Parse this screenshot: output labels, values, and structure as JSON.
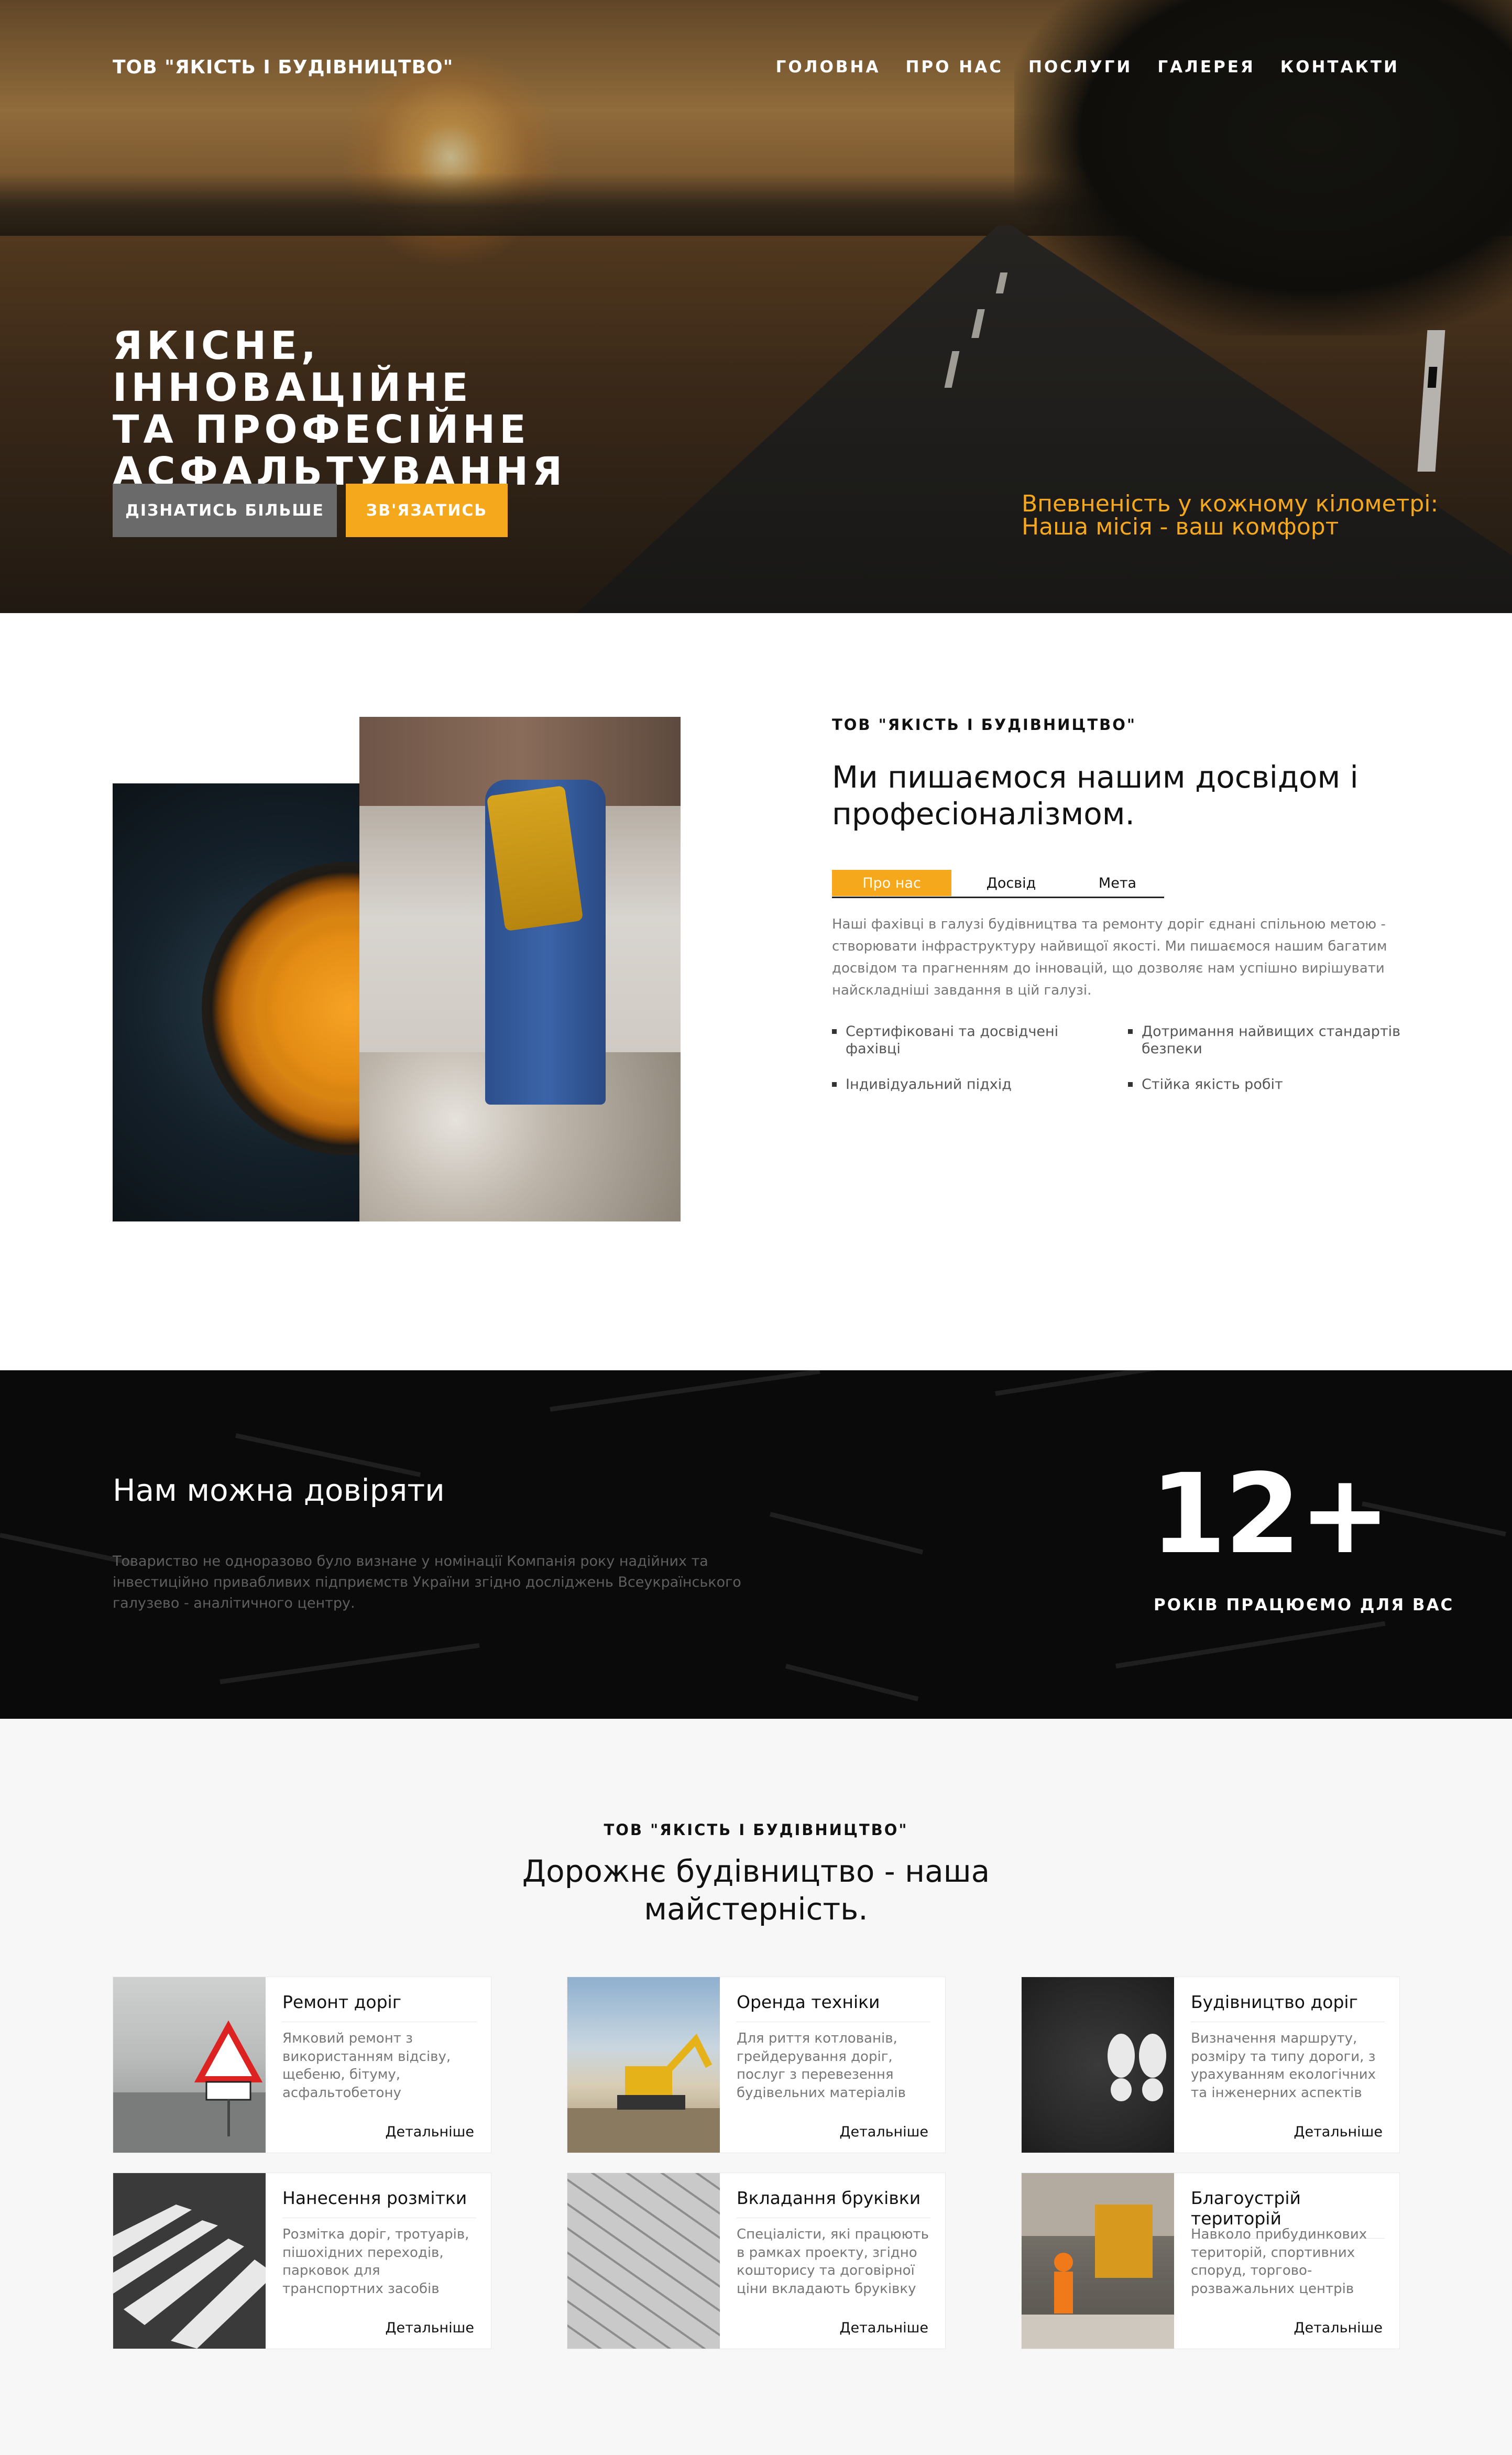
{
  "brand": "ТОВ \"ЯКІСТЬ І БУДІВНИЦТВО\"",
  "nav": [
    "ГОЛОВНА",
    "ПРО НАС",
    "ПОСЛУГИ",
    "ГАЛЕРЕЯ",
    "КОНТАКТИ"
  ],
  "hero": {
    "title_lines": [
      "ЯКІСНЕ, ІННОВАЦІЙНЕ",
      "ТА ПРОФЕСІЙНЕ",
      "АСФАЛЬТУВАННЯ"
    ],
    "btn_more": "ДІЗНАТИСЬ БІЛЬШЕ",
    "btn_contact": "ЗВ'ЯЗАТИСЬ",
    "tagline_lines": [
      "Впевненість у кожному кілометрі:",
      "Наша місія - ваш комфорт"
    ]
  },
  "about": {
    "kicker": "ТОВ \"ЯКІСТЬ І БУДІВНИЦТВО\"",
    "title_lines": [
      "Ми пишаємося нашим досвідом і",
      "професіоналізмом."
    ],
    "tabs": [
      "Про нас",
      "Досвід",
      "Мета"
    ],
    "body_lines": [
      "Наші фахівці в галузі будівництва та ремонту доріг єднані спільною метою -",
      "створювати інфраструктуру найвищої якості. Ми пишаємося нашим багатим",
      "досвідом та прагненням до інновацій, що дозволяє нам успішно вирішувати",
      "найскладніші завдання в цій галузі."
    ],
    "features": [
      "Сертифіковані та досвідчені фахівці",
      "Дотримання найвищих стандартів безпеки",
      "Індивідуальний підхід",
      "Стійка якість робіт"
    ]
  },
  "trust": {
    "title": "Нам можна довіряти",
    "text_lines": [
      "Товариство не одноразово було визнане у номінації Компанія року надійних та",
      "інвестиційно привабливих підприємств України згідно досліджень Всеукраїнського",
      "галузево - аналітичного центру."
    ],
    "number": "12+",
    "number_caption": "РОКІВ ПРАЦЮЄМО ДЛЯ ВАС"
  },
  "services": {
    "kicker": "ТОВ \"ЯКІСТЬ І БУДІВНИЦТВО\"",
    "title_lines": [
      "Дорожнє будівництво - наша",
      "майстерність."
    ],
    "more_label": "Детальніше",
    "cards": [
      {
        "title": "Ремонт доріг",
        "text": "Ямковий ремонт з використанням відсіву, щебеню, бітуму, асфальтобетону"
      },
      {
        "title": "Оренда техніки",
        "text": "Для риття котлованів, грейдерування доріг, послуг з перевезення будівельних матеріалів"
      },
      {
        "title": "Будівництво доріг",
        "text": "Визначення маршруту, розміру та типу дороги, з урахуванням екологічних та інженерних аспектів"
      },
      {
        "title": "Нанесення розмітки",
        "text": "Розмітка доріг, тротуарів, пішохідних переходів, парковок для транспортних засобів"
      },
      {
        "title": "Вкладання бруківки",
        "text": "Спеціалісти, які працюють в рамках проекту, згідно кошторису та договірної ціни вкладають бруківку"
      },
      {
        "title": "Благоустрій територій",
        "text": "Навколо прибудинкових територій, спортивних споруд, торгово-розважальних центрів"
      }
    ]
  },
  "colors": {
    "accent": "#f6a81c",
    "dark_section": "#0a0a0a",
    "light_section": "#f7f7f7"
  }
}
